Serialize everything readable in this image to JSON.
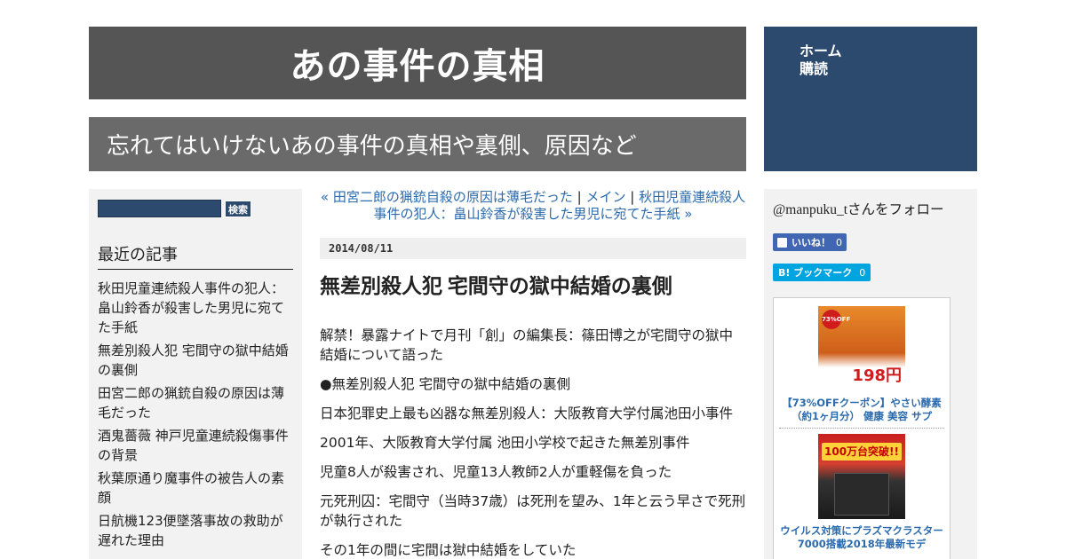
{
  "site": {
    "title": "あの事件の真相",
    "tagline": "忘れてはいけないあの事件の真相や裏側、原因など"
  },
  "nav": {
    "items": [
      {
        "label": "ホーム"
      },
      {
        "label": "購読"
      }
    ]
  },
  "search": {
    "placeholder": "",
    "button_label": "検索"
  },
  "recent": {
    "heading": "最近の記事",
    "items": [
      {
        "title": "秋田児童連続殺人事件の犯人：畠山鈴香が殺害した男児に宛てた手紙"
      },
      {
        "title": "無差別殺人犯 宅間守の獄中結婚の裏側"
      },
      {
        "title": "田宮二郎の猟銃自殺の原因は薄毛だった"
      },
      {
        "title": "酒鬼薔薇 神戸児童連続殺傷事件の背景"
      },
      {
        "title": "秋葉原通り魔事件の被告人の素顔"
      },
      {
        "title": "日航機123便墜落事故の救助が遅れた理由"
      }
    ]
  },
  "post_nav": {
    "prev_label": "« 田宮二郎の猟銃自殺の原因は薄毛だった",
    "sep1": "|",
    "main_label": "メイン",
    "sep2": "|",
    "next_label": "秋田児童連続殺人事件の犯人：畠山鈴香が殺害した男児に宛てた手紙 »"
  },
  "post": {
    "date": "2014/08/11",
    "title": "無差別殺人犯 宅間守の獄中結婚の裏側",
    "paragraphs": [
      "解禁！暴露ナイトで月刊「創」の編集長：篠田博之が宅間守の獄中結婚について語った",
      "●無差別殺人犯 宅間守の獄中結婚の裏側",
      "日本犯罪史上最も凶器な無差別殺人：大阪教育大学付属池田小事件",
      "2001年、大阪教育大学付属 池田小学校で起きた無差別事件",
      "児童8人が殺害され、児童13人教師2人が重軽傷を負った",
      "元死刑囚：宅間守（当時37歳）は死刑を望み、1年と云う早さで死刑が執行された",
      "その1年の間に宅間は獄中結婚をしていた"
    ]
  },
  "sidebar_right": {
    "follow_text": "@manpuku_tさんをフォロー",
    "fb_like_label": "いいね！",
    "fb_like_count": "0",
    "hatena_label": "B! ブックマーク",
    "hatena_count": "0",
    "ads": [
      {
        "caption": "【73%OFFクーポン】やさい酵素（約1ヶ月分） 健康 美容 サプ",
        "badge": "73%OFF",
        "price": "198円",
        "icon": "vegetable-product-image"
      },
      {
        "caption": "ウイルス対策にプラズマクラスター7000搭載2018年最新モデ",
        "banner": "100万台突破!!",
        "icon": "air-purifier-product-image"
      }
    ]
  },
  "colors": {
    "title_bar": "#555555",
    "tagline_bar": "#6a6a6a",
    "nav_bg": "#2c4a6e",
    "link": "#2a6aad",
    "sidebar_bg": "#f2f2f2",
    "fb_blue": "#4267b2",
    "hatena_blue": "#00a4de"
  }
}
